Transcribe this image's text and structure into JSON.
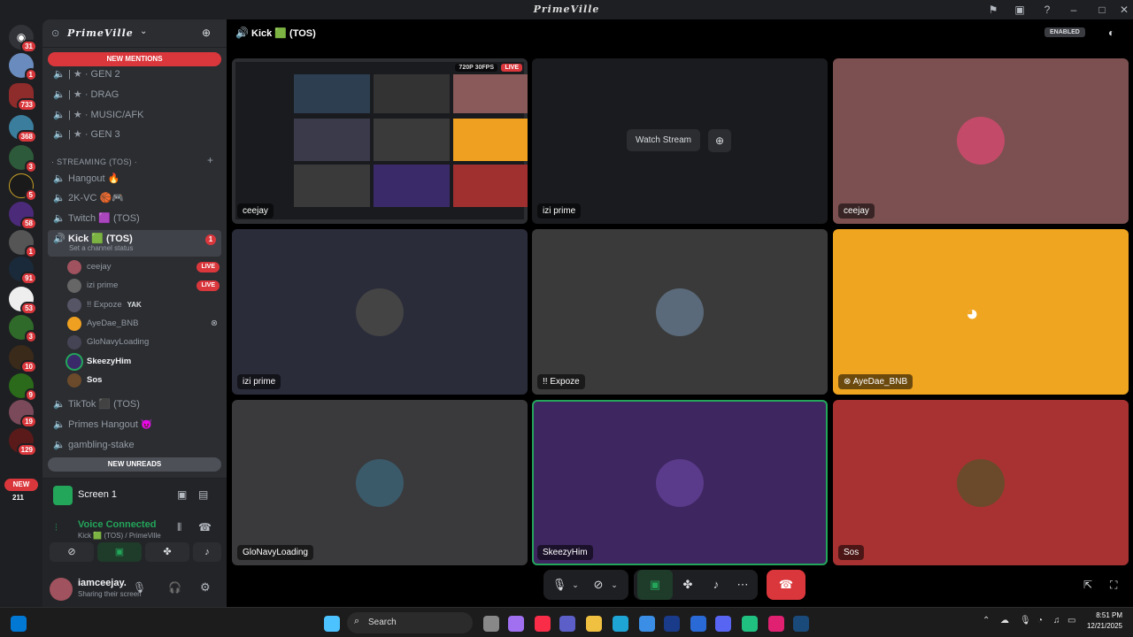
{
  "window": {
    "title": "PrimeVille"
  },
  "servers": {
    "badges": [
      "31",
      "1",
      "733",
      "368",
      "3",
      "5",
      "58",
      "1",
      "91",
      "53",
      "3",
      "10",
      "9",
      "19",
      "129"
    ],
    "new_pill": "NEW",
    "new_count": "211"
  },
  "guild": {
    "name": "PrimeVille",
    "new_mentions": "NEW MENTIONS",
    "new_unreads": "NEW UNREADS",
    "channels_top": [
      "| ★ · GEN 2",
      "| ★ · DRAG",
      "| ★ · MUSIC/AFK",
      "| ★ · GEN 3"
    ],
    "category": "· STREAMING (TOS) ·",
    "channels_streaming": [
      "Hangout 🔥",
      "2K-VC 🏀🎮",
      "Twitch 🟪 (TOS)"
    ],
    "active_channel": "Kick 🟩 (TOS)",
    "active_badge": "1",
    "channel_status": "Set a channel status",
    "members": [
      {
        "name": "ceejay",
        "live": "LIVE"
      },
      {
        "name": "izi prime",
        "live": "LIVE"
      },
      {
        "name": "!! Expoze",
        "tag": "YAK"
      },
      {
        "name": "AyeDae_BNB"
      },
      {
        "name": "GloNavyLoading"
      },
      {
        "name": "SkeezyHim"
      },
      {
        "name": "Sos"
      }
    ],
    "channels_bottom": [
      "TikTok ⬛ (TOS)",
      "Primes Hangout 😈",
      "gambling-stake"
    ]
  },
  "screen_panel": {
    "title": "Screen 1",
    "voice_status": "Voice Connected",
    "voice_channel": "Kick 🟩 (TOS) / PrimeVille"
  },
  "user": {
    "name": "iamceejay.",
    "status": "Sharing their screen"
  },
  "call": {
    "channel": "Kick 🟩 (TOS)",
    "enabled": "ENABLED",
    "stream_quality": "720P 30FPS",
    "live": "LIVE",
    "watch_stream": "Watch Stream",
    "tiles": [
      "ceejay",
      "izi prime",
      "ceejay",
      "izi prime",
      "!! Expoze",
      "AyeDae_BNB",
      "GloNavyLoading",
      "SkeezyHim",
      "Sos"
    ]
  },
  "taskbar": {
    "search": "Search",
    "time": "8:51 PM",
    "date": "12/21/2025"
  },
  "colors": {
    "accent": "#5865f2",
    "live_red": "#da373c",
    "connected_green": "#23a55a"
  }
}
